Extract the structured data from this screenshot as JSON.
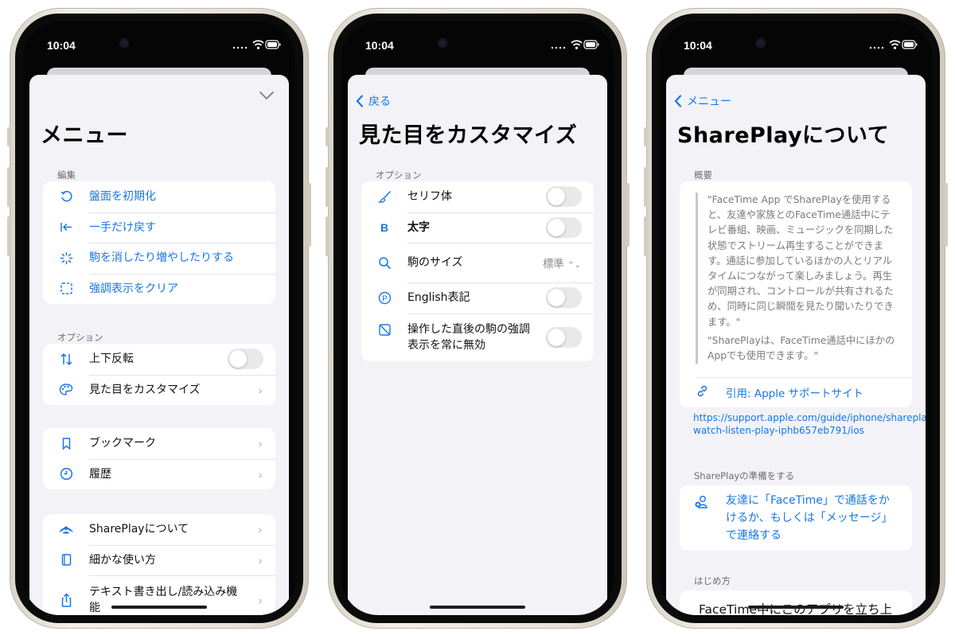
{
  "status": {
    "time": "10:04"
  },
  "colors": {
    "accent": "#1777e6",
    "grouped_bg": "#f2f2f7",
    "toggle_off": "#e9e9ea"
  },
  "screen1": {
    "title": "メニュー",
    "sections": {
      "edit": {
        "label": "編集",
        "items": [
          {
            "label": "盤面を初期化",
            "icon": "undo-circle-icon"
          },
          {
            "label": "一手だけ戻す",
            "icon": "arrow-left-to-line-icon"
          },
          {
            "label": "駒を消したり増やしたりする",
            "icon": "sparkle-burst-icon"
          },
          {
            "label": "強調表示をクリア",
            "icon": "dashed-square-icon"
          }
        ]
      },
      "options": {
        "label": "オプション",
        "items": [
          {
            "label": "上下反転",
            "icon": "arrow-up-down-icon",
            "toggle": false
          },
          {
            "label": "見た目をカスタマイズ",
            "icon": "palette-icon"
          }
        ]
      },
      "history": {
        "items": [
          {
            "label": "ブックマーク",
            "icon": "bookmark-icon"
          },
          {
            "label": "履歴",
            "icon": "clock-icon"
          }
        ]
      },
      "about": {
        "items": [
          {
            "label": "SharePlayについて",
            "icon": "shareplay-icon"
          },
          {
            "label": "細かな使い方",
            "icon": "book-icon"
          },
          {
            "label": "テキスト書き出し/読み込み機能",
            "icon": "share-icon"
          }
        ]
      }
    }
  },
  "screen2": {
    "back": "戻る",
    "title": "見た目をカスタマイズ",
    "section_label": "オプション",
    "items": [
      {
        "label": "セリフ体",
        "icon": "paintbrush-icon",
        "toggle": false
      },
      {
        "label": "太字",
        "icon": "bold-icon",
        "icon_glyph": "B",
        "toggle": false
      },
      {
        "label": "駒のサイズ",
        "icon": "magnifier-icon",
        "value": "標準"
      },
      {
        "label": "English表記",
        "icon": "p-circle-icon",
        "icon_glyph": "P",
        "toggle": false
      },
      {
        "label": "操作した直後の駒の強調表示を常に無効",
        "icon": "square-slash-icon",
        "toggle": false
      }
    ]
  },
  "screen3": {
    "back": "メニュー",
    "title": "SharePlayについて",
    "overview_label": "概要",
    "quote_p1": "\"FaceTime App でSharePlayを使用すると、友達や家族とのFaceTime通話中にテレビ番組、映画、ミュージックを同期した状態でストリーム再生することができます。通話に参加しているほかの人とリアルタイムにつながって楽しみましょう。再生が同期され、コントロールが共有されるため、同時に同じ瞬間を見たり聞いたりできます。\"",
    "quote_p2": "\"SharePlayは、FaceTime通話中にほかのAppでも使用できます。\"",
    "cite_label": "引用: Apple サポートサイト",
    "url": "https://support.apple.com/guide/iphone/shareplay-watch-listen-play-iphb657eb791/ios",
    "prepare_label": "SharePlayの準備をする",
    "prepare_text": "友達に「FaceTime」で通話をかけるか、もしくは「メッセージ」で連絡する",
    "start_label": "はじめ方",
    "start_text": "FaceTime中にこのアプリを立ち上げ、"
  }
}
